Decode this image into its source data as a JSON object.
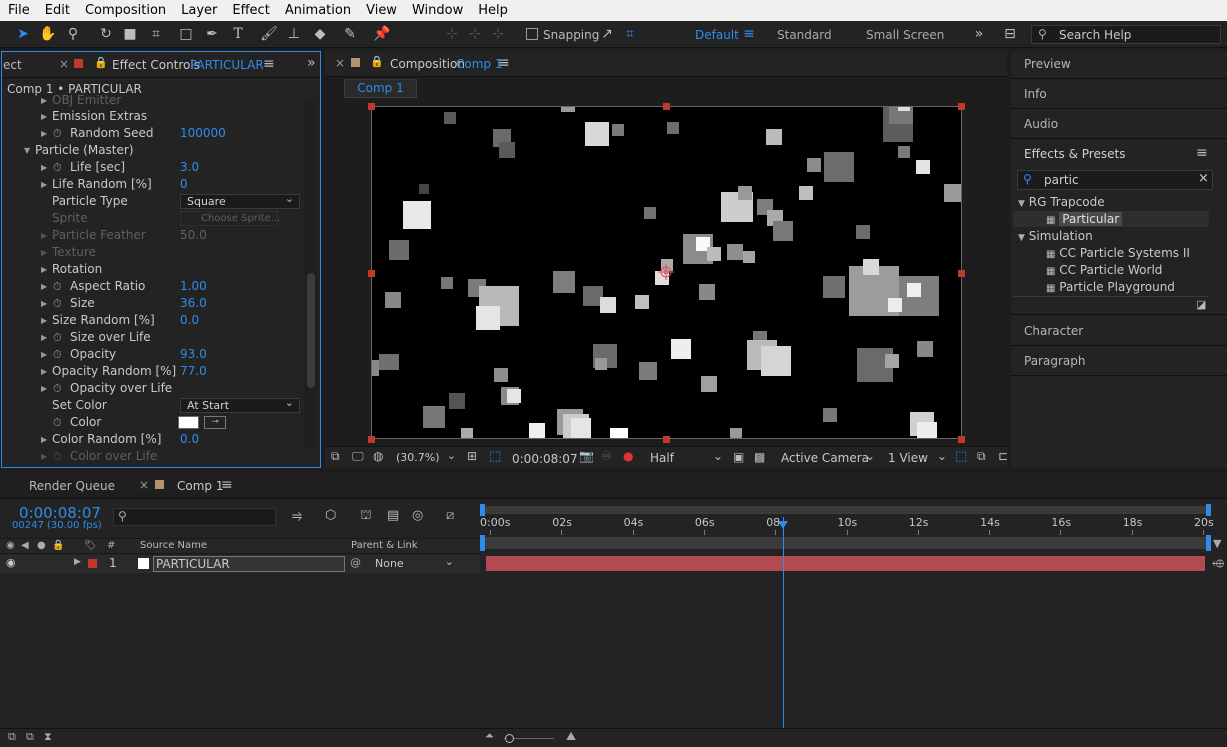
{
  "menu": [
    "File",
    "Edit",
    "Composition",
    "Layer",
    "Effect",
    "Animation",
    "View",
    "Window",
    "Help"
  ],
  "toolbar": {
    "snapping_label": "Snapping",
    "workspaces": [
      "Default",
      "Standard",
      "Small Screen"
    ],
    "search_placeholder": "Search Help"
  },
  "effect_controls": {
    "tab_partial": "ect",
    "tab_label": "Effect Controls",
    "layer_name": "PARTICULAR",
    "subheader": "Comp 1 • PARTICULAR",
    "rows": [
      {
        "name": "OBJ Emitter",
        "value": "",
        "dim": true
      },
      {
        "name": "Emission Extras",
        "value": ""
      },
      {
        "name": "Random Seed",
        "value": "100000"
      },
      {
        "name": "Particle (Master)",
        "value": ""
      },
      {
        "name": "Life [sec]",
        "value": "3.0"
      },
      {
        "name": "Life Random [%]",
        "value": "0"
      },
      {
        "name": "Particle Type",
        "value": "Square"
      },
      {
        "name": "Sprite",
        "value": "Choose Sprite...",
        "dim": true
      },
      {
        "name": "Particle Feather",
        "value": "50.0",
        "dim": true
      },
      {
        "name": "Texture",
        "value": "",
        "dim": true
      },
      {
        "name": "Rotation",
        "value": ""
      },
      {
        "name": "Aspect Ratio",
        "value": "1.00"
      },
      {
        "name": "Size",
        "value": "36.0"
      },
      {
        "name": "Size Random [%]",
        "value": "0.0"
      },
      {
        "name": "Size over Life",
        "value": ""
      },
      {
        "name": "Opacity",
        "value": "93.0"
      },
      {
        "name": "Opacity Random [%]",
        "value": "77.0"
      },
      {
        "name": "Opacity over Life",
        "value": ""
      },
      {
        "name": "Set Color",
        "value": "At Start"
      },
      {
        "name": "Color",
        "value": ""
      },
      {
        "name": "Color Random [%]",
        "value": "0.0"
      },
      {
        "name": "Color over Life",
        "value": "",
        "dim": true
      }
    ]
  },
  "composition": {
    "tab_label": "Composition",
    "comp_name": "Comp 1",
    "breadcrumb": "Comp 1",
    "zoom": "(30.7%)",
    "timecode": "0:00:08:07",
    "resolution": "Half",
    "camera": "Active Camera",
    "views": "1 View"
  },
  "right_panel": {
    "sections": [
      "Preview",
      "Info",
      "Audio",
      "Effects & Presets",
      "Character",
      "Paragraph"
    ],
    "search_value": "partic",
    "tree": [
      {
        "group": "RG Trapcode",
        "items": [
          "Particular"
        ]
      },
      {
        "group": "Simulation",
        "items": [
          "CC Particle Systems II",
          "CC Particle World",
          "Particle Playground"
        ]
      }
    ]
  },
  "timeline": {
    "render_queue_label": "Render Queue",
    "comp_tab": "Comp 1",
    "timecode": "0:00:08:07",
    "frames": "00247 (30.00 fps)",
    "col_source": "Source Name",
    "col_parent": "Parent & Link",
    "col_num": "#",
    "layer": {
      "index": "1",
      "name": "PARTICULAR",
      "parent": "None"
    },
    "ruler": [
      "0:00s",
      "02s",
      "04s",
      "06s",
      "08",
      "10s",
      "12s",
      "14s",
      "16s",
      "18s",
      "20s"
    ],
    "playhead_seconds": 8.23
  }
}
